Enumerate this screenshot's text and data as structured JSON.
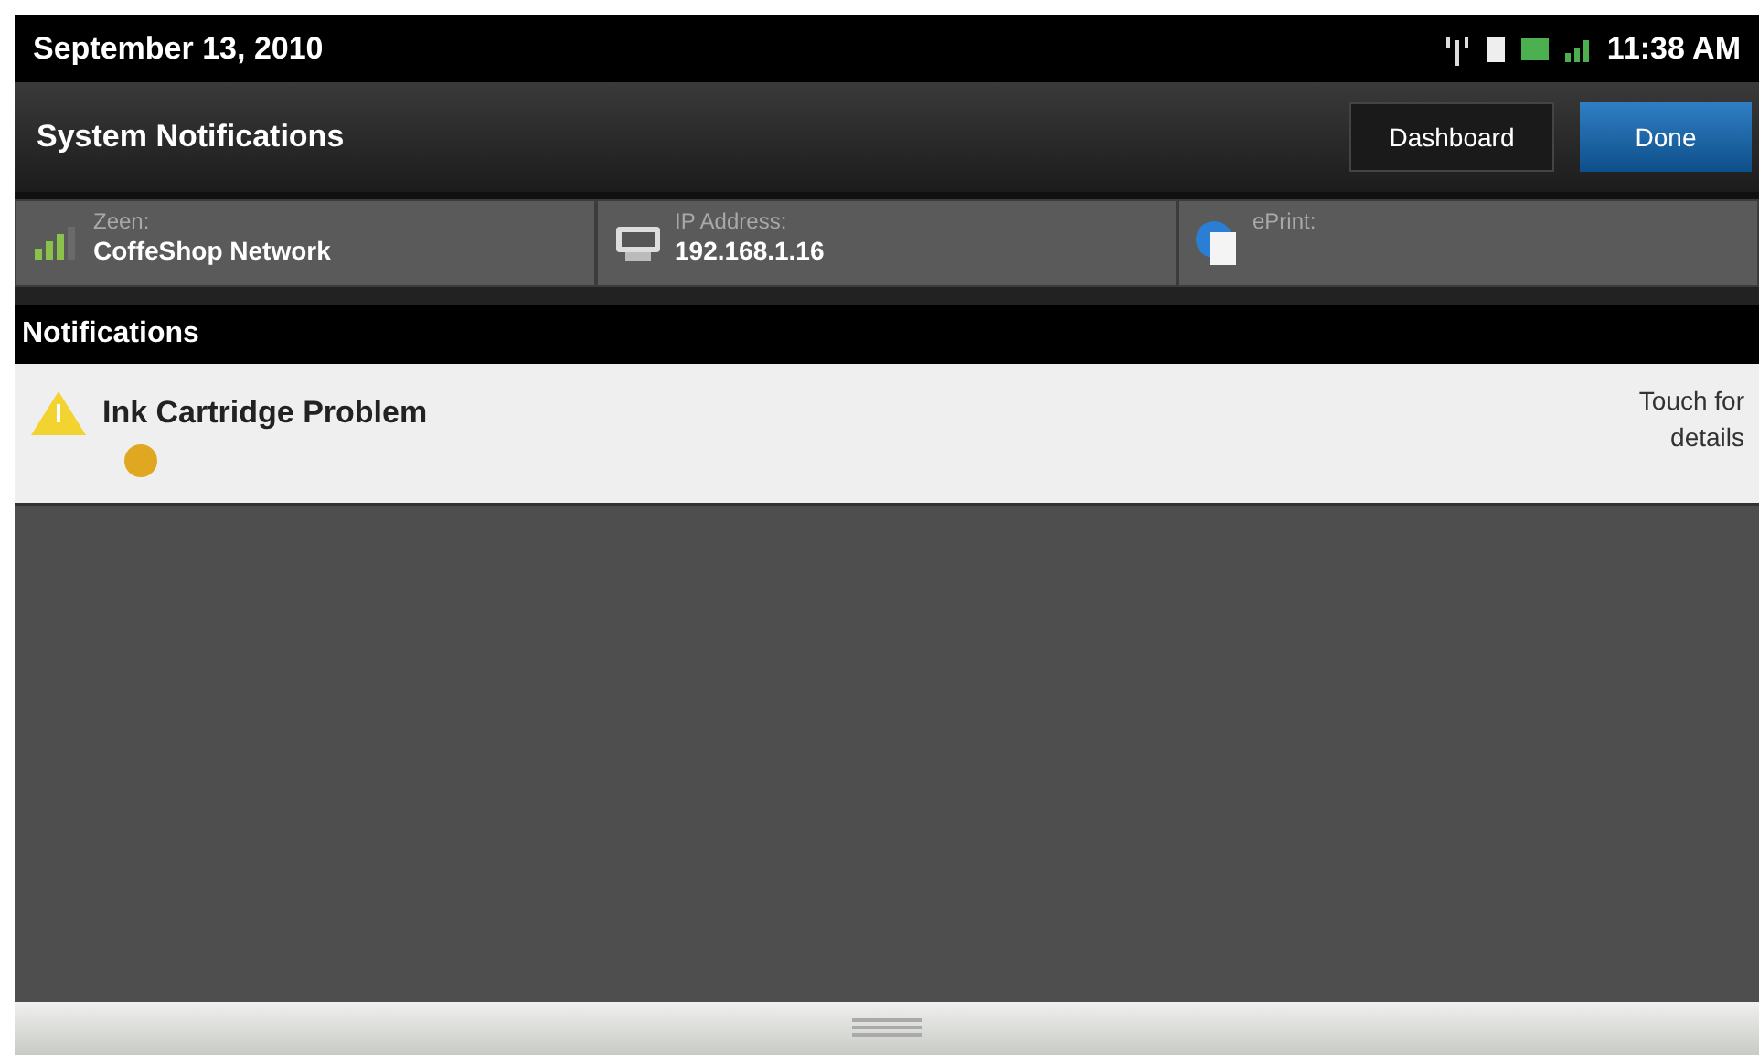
{
  "status_bar": {
    "date": "September 13, 2010",
    "time": "11:38 AM"
  },
  "title_bar": {
    "title": "System Notifications",
    "buttons": [
      {
        "label": "Dashboard",
        "kind": "plain"
      },
      {
        "label": "Done",
        "kind": "primary"
      }
    ]
  },
  "info_tiles": [
    {
      "kind": "wifi",
      "label": "Zeen:",
      "value": "CoffeShop Network"
    },
    {
      "kind": "ip",
      "label": "IP Address:",
      "value": "192.168.1.16"
    },
    {
      "kind": "eprint",
      "label": "ePrint:"
    }
  ],
  "notifications": {
    "header": "Notifications",
    "items": [
      {
        "title": "Ink Cartridge Problem",
        "color": "#e0a820",
        "hint": "Touch for details"
      }
    ]
  }
}
